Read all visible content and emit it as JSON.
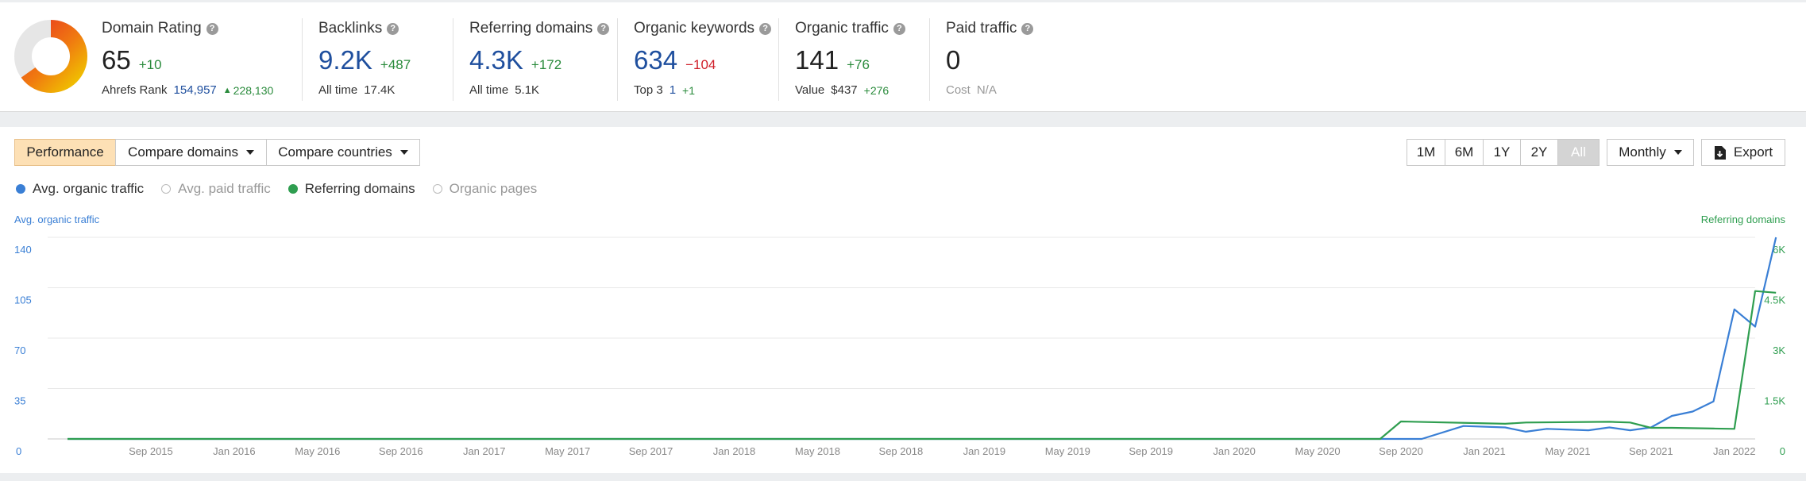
{
  "metrics": {
    "domain_rating": {
      "title": "Domain Rating",
      "value": "65",
      "delta": "+10",
      "rank_label": "Ahrefs Rank",
      "rank_value": "154,957",
      "rank_delta": "228,130",
      "donut_fraction": 0.65
    },
    "backlinks": {
      "title": "Backlinks",
      "value": "9.2K",
      "delta": "+487",
      "sub_label": "All time",
      "sub_value": "17.4K"
    },
    "referring_domains": {
      "title": "Referring domains",
      "value": "4.3K",
      "delta": "+172",
      "sub_label": "All time",
      "sub_value": "5.1K"
    },
    "organic_keywords": {
      "title": "Organic keywords",
      "value": "634",
      "delta": "−104",
      "sub_label": "Top 3",
      "sub_value": "1",
      "sub_delta": "+1"
    },
    "organic_traffic": {
      "title": "Organic traffic",
      "value": "141",
      "delta": "+76",
      "sub_label": "Value",
      "sub_value": "$437",
      "sub_delta": "+276"
    },
    "paid_traffic": {
      "title": "Paid traffic",
      "value": "0",
      "sub_label": "Cost",
      "sub_value": "N/A"
    }
  },
  "toolbar": {
    "performance": "Performance",
    "compare_domains": "Compare domains",
    "compare_countries": "Compare countries",
    "ranges": [
      "1M",
      "6M",
      "1Y",
      "2Y",
      "All"
    ],
    "interval": "Monthly",
    "export": "Export"
  },
  "legend": {
    "organic": "Avg. organic traffic",
    "paid": "Avg. paid traffic",
    "refdomains": "Referring domains",
    "pages": "Organic pages"
  },
  "colors": {
    "organic": "#3a7fd5",
    "refdomains": "#2f9e50",
    "donut_hi": "#e8371f",
    "donut_lo": "#f0c400",
    "donut_bg": "#e6e6e6"
  },
  "chart_data": {
    "type": "line",
    "ylabel_left": "Avg. organic traffic",
    "ylabel_right": "Referring domains",
    "y_left_ticks": [
      "0",
      "35",
      "70",
      "105",
      "140"
    ],
    "y_right_ticks": [
      "0",
      "1.5K",
      "3K",
      "4.5K",
      "6K"
    ],
    "ylim_left": [
      0,
      140
    ],
    "ylim_right": [
      0,
      6000
    ],
    "x_ticks": [
      "Sep 2015",
      "Jan 2016",
      "May 2016",
      "Sep 2016",
      "Jan 2017",
      "May 2017",
      "Sep 2017",
      "Jan 2018",
      "May 2018",
      "Sep 2018",
      "Jan 2019",
      "May 2019",
      "Sep 2019",
      "Jan 2020",
      "May 2020",
      "Sep 2020",
      "Jan 2021",
      "May 2021",
      "Sep 2021",
      "Jan 2022"
    ],
    "x_start": "2015-05",
    "x_end": "2022-02",
    "grid": true,
    "series": [
      {
        "name": "Avg. organic traffic",
        "axis": "left",
        "points": [
          [
            "2015-05",
            0
          ],
          [
            "2020-10",
            0
          ],
          [
            "2020-12",
            9
          ],
          [
            "2021-02",
            8
          ],
          [
            "2021-03",
            5
          ],
          [
            "2021-04",
            7
          ],
          [
            "2021-06",
            6
          ],
          [
            "2021-07",
            8
          ],
          [
            "2021-08",
            6
          ],
          [
            "2021-09",
            8
          ],
          [
            "2021-10",
            16
          ],
          [
            "2021-11",
            19
          ],
          [
            "2021-12",
            26
          ],
          [
            "2022-01",
            90
          ],
          [
            "2022-02",
            78
          ],
          [
            "2022-03",
            140
          ]
        ]
      },
      {
        "name": "Referring domains",
        "axis": "right",
        "points": [
          [
            "2015-05",
            0
          ],
          [
            "2020-08",
            0
          ],
          [
            "2020-09",
            520
          ],
          [
            "2021-02",
            450
          ],
          [
            "2021-03",
            490
          ],
          [
            "2021-07",
            510
          ],
          [
            "2021-08",
            490
          ],
          [
            "2021-09",
            330
          ],
          [
            "2021-10",
            330
          ],
          [
            "2021-12",
            310
          ],
          [
            "2022-01",
            300
          ],
          [
            "2022-02",
            4400
          ],
          [
            "2022-03",
            4350
          ]
        ]
      }
    ]
  }
}
